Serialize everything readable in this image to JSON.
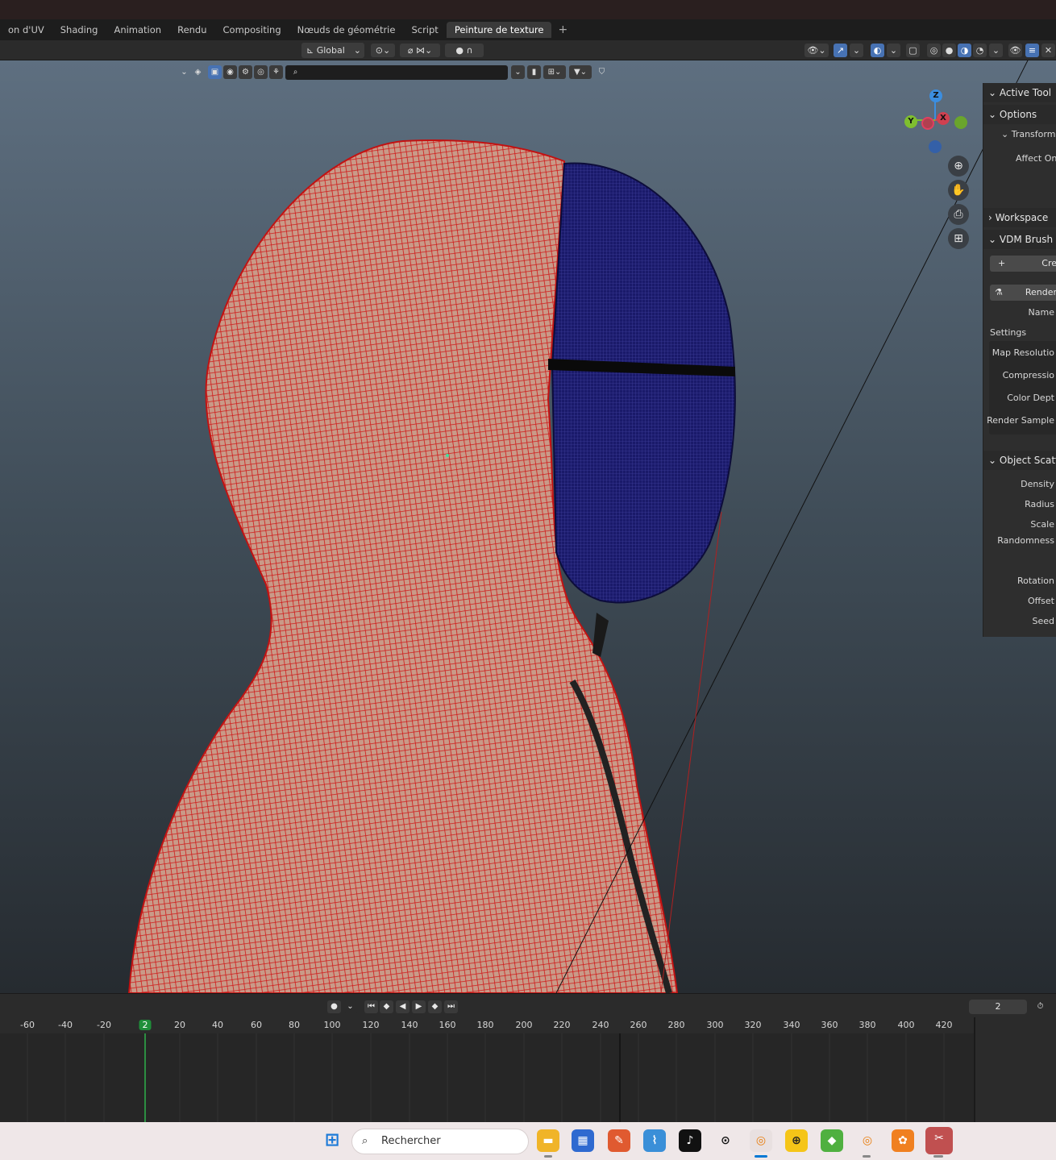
{
  "workspace_tabs": [
    "on d'UV",
    "Shading",
    "Animation",
    "Rendu",
    "Compositing",
    "Nœuds de géométrie",
    "Script",
    "Peinture de texture"
  ],
  "active_tab": "Peinture de texture",
  "header": {
    "orientation_label": "Global"
  },
  "viewport": {
    "search_placeholder": "",
    "gizmo": {
      "z": "Z",
      "y": "Y",
      "x": "X"
    },
    "colors": {
      "mesh_red": "#d01818",
      "mesh_blue": "#1a1a6a",
      "skin": "#c99a88"
    }
  },
  "npanel": {
    "active_tool": "Active Tool",
    "options": "Options",
    "transform": "Transform",
    "affect_only": "Affect Only",
    "workspace": "Workspace",
    "vdm": "VDM Brush B",
    "create_btn": "Cre",
    "render_btn": "Render",
    "name_label": "Name",
    "settings": "Settings",
    "map_resolution": "Map Resolutio",
    "compression": "Compressio",
    "color_depth": "Color Dept",
    "render_samples": "Render Sample",
    "object_scatter": "Object Scatte",
    "density": "Density",
    "radius": "Radius",
    "scale": "Scale",
    "randomness": "Randomness",
    "rotation": "Rotation",
    "offset": "Offset",
    "seed": "Seed"
  },
  "timeline": {
    "current_frame": "2",
    "ruler_ticks": [
      "-60",
      "-40",
      "-20",
      "2",
      "20",
      "40",
      "60",
      "80",
      "100",
      "120",
      "140",
      "160",
      "180",
      "200",
      "220",
      "240",
      "260",
      "280",
      "300",
      "320",
      "340",
      "360",
      "380",
      "400",
      "420"
    ]
  },
  "taskbar": {
    "search_label": "Rechercher"
  }
}
